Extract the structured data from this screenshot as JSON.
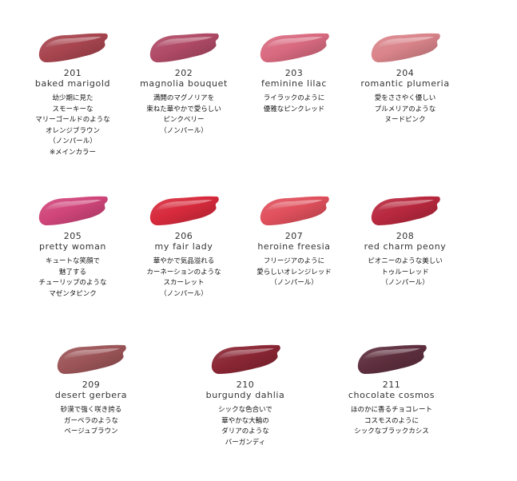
{
  "shades": [
    {
      "code": "201",
      "name": "baked marigold",
      "color": "#a8454f",
      "desc": [
        "幼少期に見た",
        "スモーキーな",
        "マリーゴールドのような",
        "オレンジブラウン",
        "（ノンパール）",
        "※メインカラー"
      ]
    },
    {
      "code": "202",
      "name": "magnolia bouquet",
      "color": "#b04a66",
      "desc": [
        "満開のマグノリアを",
        "束ねた華やかで愛らしい",
        "ピンクベリー",
        "（ノンパール）"
      ]
    },
    {
      "code": "203",
      "name": "feminine lilac",
      "color": "#d96a80",
      "desc": [
        "ライラックのように",
        "優雅なピンクレッド"
      ]
    },
    {
      "code": "204",
      "name": "romantic plumeria",
      "color": "#d9848a",
      "desc": [
        "愛をささやく優しい",
        "プルメリアのような",
        "ヌードピンク"
      ]
    },
    {
      "code": "205",
      "name": "pretty woman",
      "color": "#d0457a",
      "desc": [
        "キュートな笑顔で",
        "魅了する",
        "チューリップのような",
        "マゼンタピンク"
      ]
    },
    {
      "code": "206",
      "name": "my fair lady",
      "color": "#d72a3c",
      "desc": [
        "華やかで気品溢れる",
        "カーネーションのような",
        "スカーレット",
        "（ノンパール）"
      ]
    },
    {
      "code": "207",
      "name": "heroine freesia",
      "color": "#e0505c",
      "desc": [
        "フリージアのように",
        "愛らしいオレンジレッド",
        "（ノンパール）"
      ]
    },
    {
      "code": "208",
      "name": "red charm peony",
      "color": "#b8283e",
      "desc": [
        "ピオニーのような美しい",
        "トゥルーレッド",
        "（ノンパール）"
      ]
    },
    {
      "code": "209",
      "name": "desert gerbera",
      "color": "#9c5558",
      "desc": [
        "砂漠で強く咲き誇る",
        "ガーベラのような",
        "ベージュブラウン"
      ]
    },
    {
      "code": "210",
      "name": "burgundy dahlia",
      "color": "#8a2634",
      "desc": [
        "シックな色合いで",
        "華やかな大輪の",
        "ダリアのような",
        "バーガンディ"
      ]
    },
    {
      "code": "211",
      "name": "chocolate cosmos",
      "color": "#5e2f3e",
      "desc": [
        "ほのかに香るチョコレート",
        "コスモスのように",
        "シックなブラックカシス"
      ]
    }
  ]
}
